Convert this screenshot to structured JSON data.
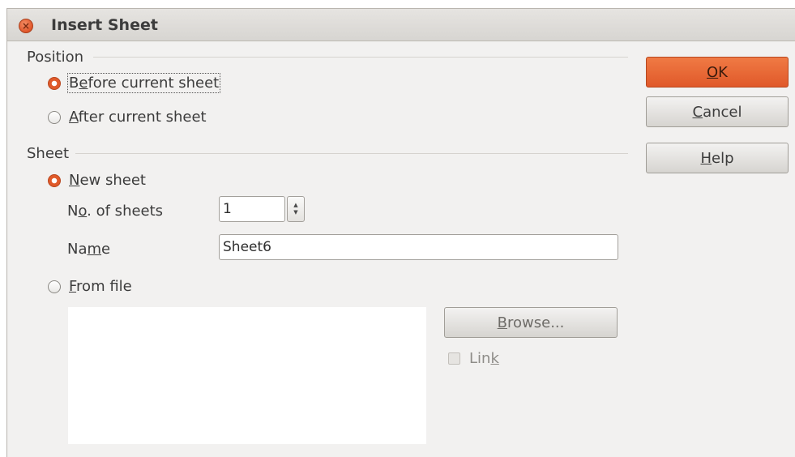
{
  "window": {
    "title": "Insert Sheet"
  },
  "position": {
    "label": "Position",
    "before": {
      "pre": "B",
      "ul": "e",
      "post": "fore current sheet",
      "checked": true
    },
    "after": {
      "pre": "",
      "ul": "A",
      "post": "fter current sheet",
      "checked": false
    }
  },
  "sheet": {
    "label": "Sheet",
    "new_sheet": {
      "pre": "",
      "ul": "N",
      "post": "ew sheet",
      "checked": true
    },
    "count_label": {
      "pre": "N",
      "ul": "o",
      "post": ". of sheets"
    },
    "count_value": "1",
    "name_label": {
      "pre": "Na",
      "ul": "m",
      "post": "e"
    },
    "name_value": "Sheet6",
    "from_file": {
      "pre": "",
      "ul": "F",
      "post": "rom file",
      "checked": false
    },
    "browse": {
      "pre": "",
      "ul": "B",
      "post": "rowse..."
    },
    "link": {
      "pre": "Lin",
      "ul": "k",
      "post": "",
      "checked": false,
      "enabled": false
    }
  },
  "buttons": {
    "ok": {
      "pre": "",
      "ul": "O",
      "post": "K"
    },
    "cancel": {
      "pre": "",
      "ul": "C",
      "post": "ancel"
    },
    "help": {
      "pre": "",
      "ul": "H",
      "post": "elp"
    }
  },
  "colors": {
    "accent": "#e0592a",
    "dialog_bg": "#f2f1f0"
  },
  "icons": {
    "close": "close-icon",
    "spin_up": "arrow-up-icon",
    "spin_down": "arrow-down-icon"
  }
}
